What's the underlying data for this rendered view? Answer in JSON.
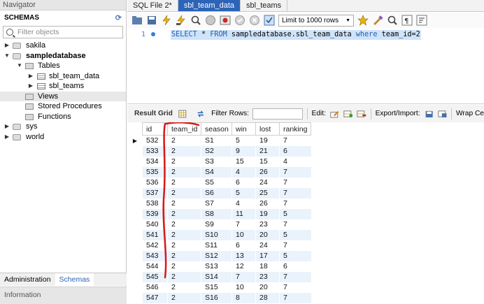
{
  "navigator": {
    "title": "Navigator",
    "schemas_header": "SCHEMAS",
    "filter_placeholder": "Filter objects",
    "tree": {
      "sakila": "sakila",
      "sampledatabase": "sampledatabase",
      "tables": "Tables",
      "sbl_team_data": "sbl_team_data",
      "sbl_teams": "sbl_teams",
      "views": "Views",
      "stored_procedures": "Stored Procedures",
      "functions": "Functions",
      "sys": "sys",
      "world": "world"
    },
    "bottom_tabs": [
      "Administration",
      "Schemas"
    ],
    "information": "Information"
  },
  "tabs": [
    "SQL File 2*",
    "sbl_team_data",
    "sbl_teams"
  ],
  "toolbar": {
    "limit": "Limit to 1000 rows"
  },
  "editor": {
    "line_number": "1",
    "query_parts": {
      "select": "SELECT",
      "star": " * ",
      "from": "FROM",
      "table": " sampledatabase.sbl_team_data ",
      "where": "where",
      "cond": " team_id=2"
    }
  },
  "result_bar": {
    "result_grid": "Result Grid",
    "filter_rows": "Filter Rows:",
    "edit": "Edit:",
    "export_import": "Export/Import:",
    "wrap": "Wrap Ce"
  },
  "grid": {
    "columns": [
      "id",
      "team_id",
      "season",
      "win",
      "lost",
      "ranking"
    ],
    "rows": [
      [
        "532",
        "2",
        "S1",
        "5",
        "19",
        "7"
      ],
      [
        "533",
        "2",
        "S2",
        "9",
        "21",
        "6"
      ],
      [
        "534",
        "2",
        "S3",
        "15",
        "15",
        "4"
      ],
      [
        "535",
        "2",
        "S4",
        "4",
        "26",
        "7"
      ],
      [
        "536",
        "2",
        "S5",
        "6",
        "24",
        "7"
      ],
      [
        "537",
        "2",
        "S6",
        "5",
        "25",
        "7"
      ],
      [
        "538",
        "2",
        "S7",
        "4",
        "26",
        "7"
      ],
      [
        "539",
        "2",
        "S8",
        "11",
        "19",
        "5"
      ],
      [
        "540",
        "2",
        "S9",
        "7",
        "23",
        "7"
      ],
      [
        "541",
        "2",
        "S10",
        "10",
        "20",
        "5"
      ],
      [
        "542",
        "2",
        "S11",
        "6",
        "24",
        "7"
      ],
      [
        "543",
        "2",
        "S12",
        "13",
        "17",
        "5"
      ],
      [
        "544",
        "2",
        "S13",
        "12",
        "18",
        "6"
      ],
      [
        "545",
        "2",
        "S14",
        "7",
        "23",
        "7"
      ],
      [
        "546",
        "2",
        "S15",
        "10",
        "20",
        "7"
      ],
      [
        "547",
        "2",
        "S16",
        "8",
        "28",
        "7"
      ]
    ]
  },
  "colors": {
    "accent": "#2d64b8",
    "annotation": "#d81818",
    "row_alt": "#eaf3fc"
  }
}
